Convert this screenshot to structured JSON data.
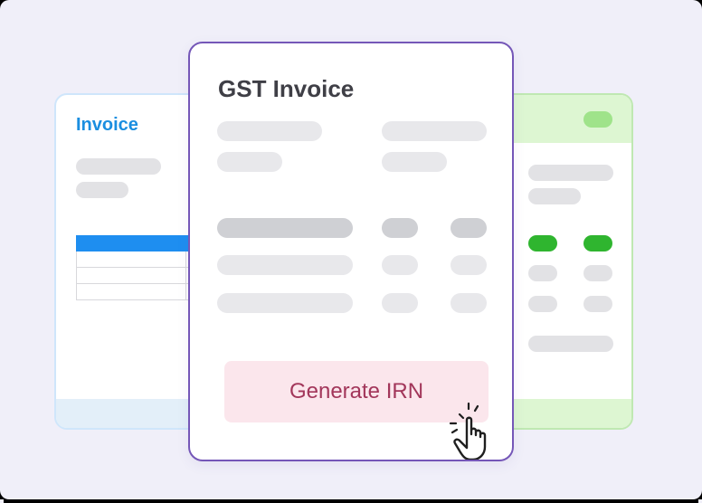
{
  "left_card": {
    "title": "Invoice"
  },
  "main_card": {
    "title": "GST Invoice",
    "button_label": "Generate IRN"
  },
  "colors": {
    "main_border": "#7557b8",
    "left_title": "#1a8ee0",
    "table_header": "#1e8ef0",
    "status_green": "#2fb52f",
    "button_bg": "#fbe6ec",
    "button_text": "#a2365a"
  },
  "icons": {
    "cursor": "hand-pointer-icon"
  }
}
